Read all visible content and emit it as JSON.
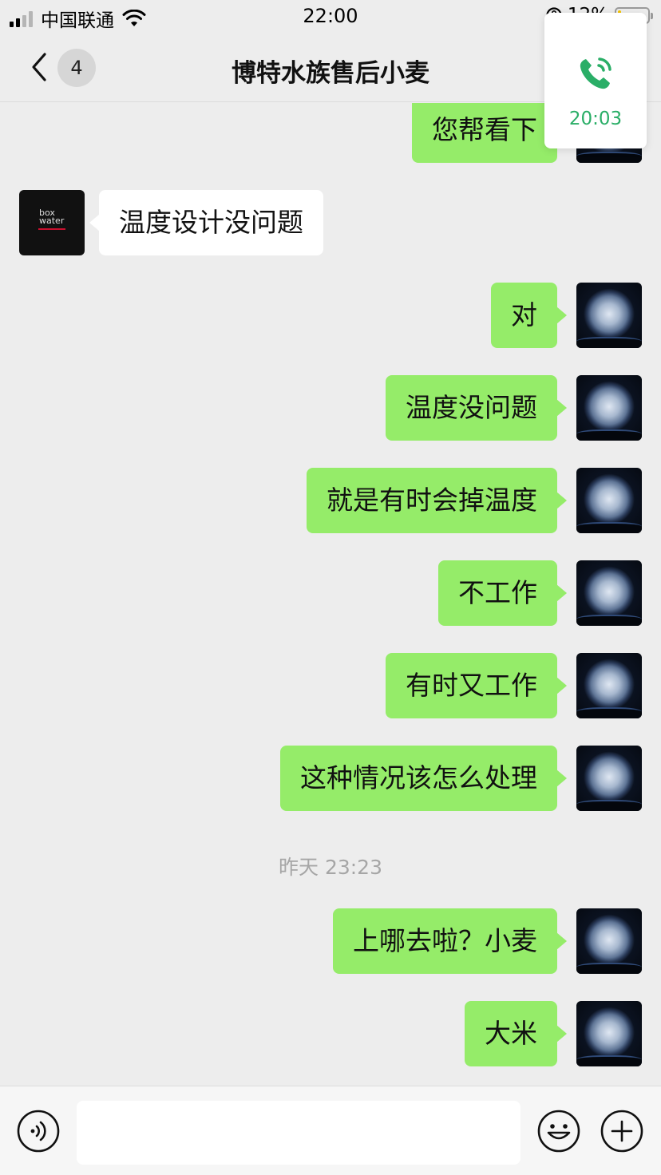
{
  "status_bar": {
    "carrier": "中国联通",
    "time": "22:00",
    "battery_percent": "12%",
    "battery_level": 0.12
  },
  "nav": {
    "badge_count": "4",
    "title": "博特水族售后小麦",
    "back_icon": "chevron-left-icon"
  },
  "call_float": {
    "duration": "20:03",
    "icon": "phone-call-icon",
    "color": "#2aae67"
  },
  "messages": [
    {
      "side": "me",
      "text": "您帮看下"
    },
    {
      "side": "other",
      "text": "温度设计没问题"
    },
    {
      "side": "me",
      "text": "对"
    },
    {
      "side": "me",
      "text": "温度没问题"
    },
    {
      "side": "me",
      "text": "就是有时会掉温度"
    },
    {
      "side": "me",
      "text": "不工作"
    },
    {
      "side": "me",
      "text": "有时又工作"
    },
    {
      "side": "me",
      "text": "这种情况该怎么处理"
    },
    {
      "side": "time",
      "text": "昨天 23:23"
    },
    {
      "side": "me",
      "text": "上哪去啦？小麦"
    },
    {
      "side": "me",
      "text": "大米"
    }
  ],
  "other_avatar_text": "box water",
  "colors": {
    "my_bubble": "#95ec69",
    "other_bubble": "#ffffff",
    "background": "#ededed"
  },
  "input_bar": {
    "value": "",
    "left_icon": "voice-icon",
    "emoji_icon": "emoji-icon",
    "plus_icon": "plus-icon"
  }
}
